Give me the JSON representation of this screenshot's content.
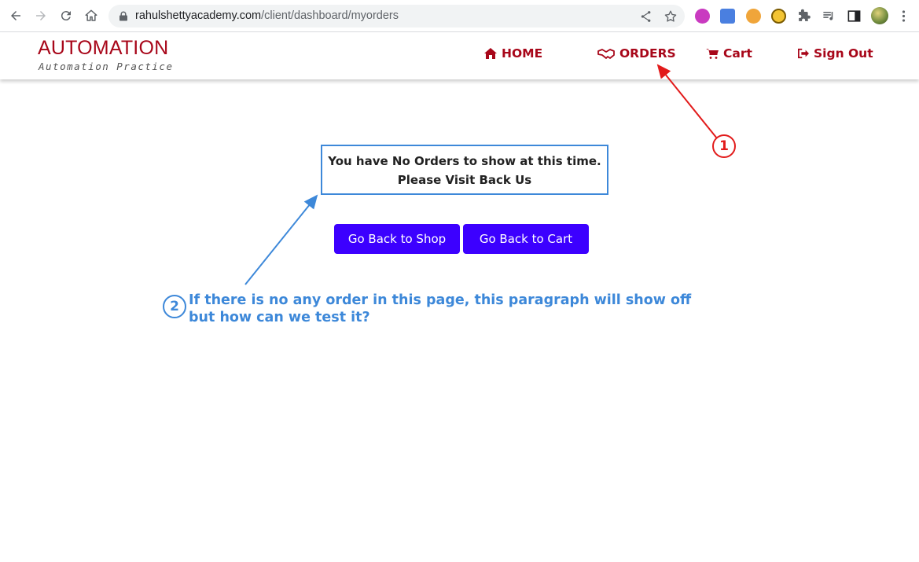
{
  "browser": {
    "url_domain": "rahulshettyacademy.com",
    "url_path": "/client/dashboard/myorders",
    "nav_icons": [
      "back-arrow-icon",
      "forward-arrow-icon",
      "reload-icon",
      "home-icon"
    ],
    "omnibox_icons": [
      "lock-icon",
      "share-icon",
      "star-icon"
    ],
    "extension_icons": [
      "lr-extension-icon",
      "translate-extension-icon",
      "cookie-extension-icon",
      "speed-extension-icon",
      "puzzle-extensions-icon",
      "media-queue-icon",
      "side-panel-icon",
      "profile-avatar-icon",
      "kebab-menu-icon"
    ]
  },
  "header": {
    "logo_title": "AUTOMATION",
    "logo_subtitle": "Automation Practice",
    "nav": [
      {
        "label": "HOME",
        "icon": "home-icon"
      },
      {
        "label": "ORDERS",
        "icon": "handshake-icon"
      },
      {
        "label": "Cart",
        "icon": "cart-icon"
      },
      {
        "label": "Sign Out",
        "icon": "sign-out-icon"
      }
    ]
  },
  "main": {
    "empty_message_line1": "You have No Orders to show at this time.",
    "empty_message_line2": "Please Visit Back Us",
    "back_to_shop_label": "Go Back to Shop",
    "back_to_cart_label": "Go Back to Cart"
  },
  "annotations": {
    "marker1": "1",
    "marker2": "2",
    "note_line1": "If there is no any order in this page, this paragraph will show off",
    "note_line2": "but how can we test it?"
  },
  "colors": {
    "brand_red": "#a8071a",
    "button_blue": "#3c00ff",
    "annotation_red": "#e21b1b",
    "annotation_blue": "#3d88d9"
  }
}
